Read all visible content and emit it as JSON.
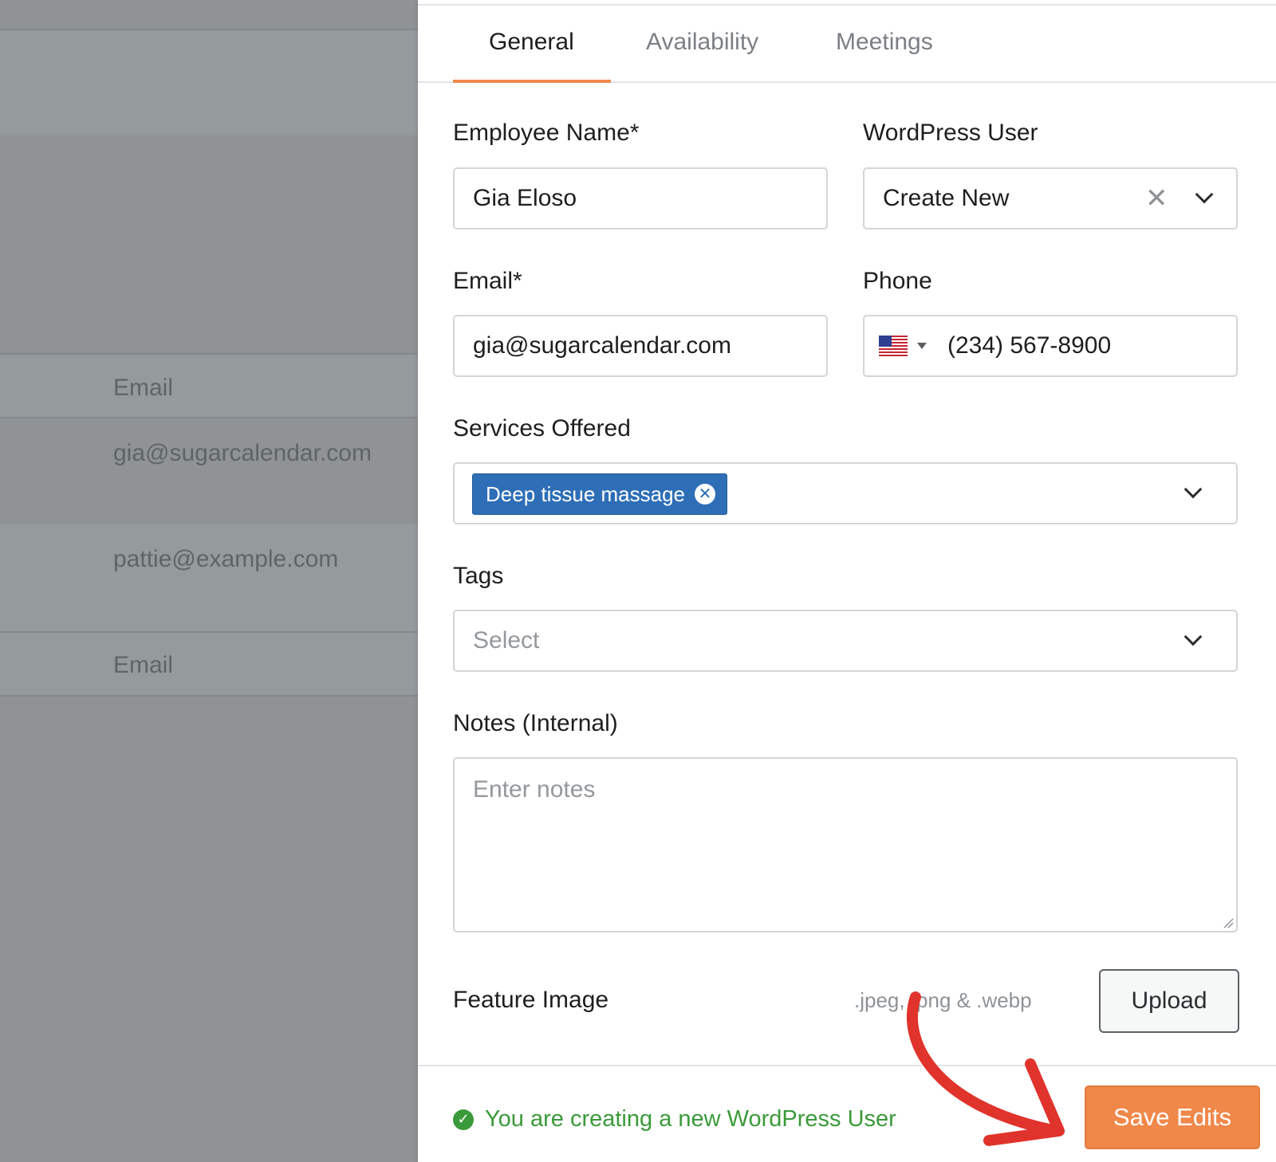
{
  "background": {
    "rows": [
      {
        "text": "Email"
      },
      {
        "text": "gia@sugarcalendar.com"
      },
      {
        "text": "pattie@example.com"
      },
      {
        "text": "Email"
      }
    ]
  },
  "tabs": [
    {
      "label": "General",
      "active": true
    },
    {
      "label": "Availability",
      "active": false
    },
    {
      "label": "Meetings",
      "active": false
    }
  ],
  "form": {
    "employee_name": {
      "label": "Employee Name*",
      "value": "Gia Eloso"
    },
    "wordpress_user": {
      "label": "WordPress User",
      "value": "Create New"
    },
    "email": {
      "label": "Email*",
      "value": "gia@sugarcalendar.com"
    },
    "phone": {
      "label": "Phone",
      "value": "(234) 567-8900",
      "flag": "us-flag-icon"
    },
    "services": {
      "label": "Services Offered",
      "chips": [
        "Deep tissue massage"
      ]
    },
    "tags": {
      "label": "Tags",
      "placeholder": "Select"
    },
    "notes": {
      "label": "Notes (Internal)",
      "placeholder": "Enter notes"
    },
    "feature_image": {
      "label": "Feature Image",
      "hint": ".jpeg, .png & .webp",
      "button": "Upload"
    }
  },
  "footer": {
    "status": "You are creating a new WordPress User",
    "save_label": "Save Edits"
  },
  "colors": {
    "accent": "#f0884a",
    "chip": "#2e6eb6",
    "success": "#3a9a3a",
    "annotation_arrow": "#e0332b"
  }
}
